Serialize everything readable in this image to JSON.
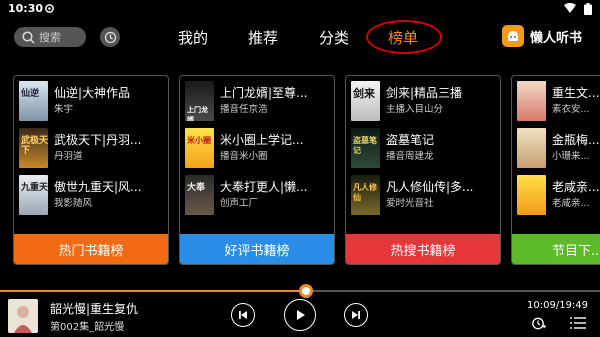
{
  "status": {
    "time": "10:30"
  },
  "nav": {
    "search_placeholder": "搜索",
    "tabs": [
      "我的",
      "推荐",
      "分类",
      "榜单"
    ],
    "active_tab": "榜单",
    "brand": "懒人听书",
    "accent": "#f08a24"
  },
  "cards": [
    {
      "footer": "热门书籍榜",
      "books": [
        {
          "title": "仙逆|大神作品",
          "author": "朱宇",
          "cover_text": "仙逆"
        },
        {
          "title": "武极天下|丹羽...",
          "author": "丹羽道",
          "cover_text": "武极天下"
        },
        {
          "title": "傲世九重天|风...",
          "author": "我影随风",
          "cover_text": "九重天"
        }
      ]
    },
    {
      "footer": "好评书籍榜",
      "books": [
        {
          "title": "上门龙婿|至尊...",
          "author": "播音任京浩",
          "cover_text": "上门龙婿"
        },
        {
          "title": "米小圈上学记...",
          "author": "播音米小圈",
          "cover_text": "米小圈"
        },
        {
          "title": "大奉打更人|懒...",
          "author": "创声工厂",
          "cover_text": "大奉"
        }
      ]
    },
    {
      "footer": "热搜书籍榜",
      "books": [
        {
          "title": "剑来|精品三播",
          "author": "主播入目山分",
          "cover_text": "剑来"
        },
        {
          "title": "盗墓笔记",
          "author": "播音周建龙",
          "cover_text": "盗墓笔记"
        },
        {
          "title": "凡人修仙传|多...",
          "author": "爱时光音社",
          "cover_text": "凡人修仙"
        }
      ]
    },
    {
      "footer": "节目下...",
      "books": [
        {
          "title": "重生文...",
          "author": "素衣安...",
          "cover_text": ""
        },
        {
          "title": "金瓶梅...",
          "author": "小珊来...",
          "cover_text": ""
        },
        {
          "title": "老咸亲...",
          "author": "老咸亲...",
          "cover_text": ""
        }
      ]
    }
  ],
  "player": {
    "title": "韶光慢|重生复仇",
    "episode": "第002集_韶光慢",
    "time": "10:09/19:49",
    "progress": 0.51
  }
}
